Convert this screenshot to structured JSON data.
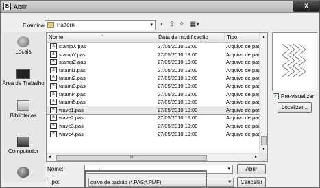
{
  "window": {
    "title": "Abrir",
    "app_icon_glyph": "B",
    "close_glyph": "x"
  },
  "toolbar": {
    "lookin_label": "Examinar:",
    "lookin_value": "Pattern",
    "combo_arrow": "▾",
    "back_glyph": "◐",
    "up_glyph": "⇧",
    "newfolder_glyph": "✧",
    "views_glyph": "▦▾"
  },
  "places": [
    {
      "label": "Locais",
      "icon": "recent-places-icon"
    },
    {
      "label": "Área de Trabalho",
      "icon": "desktop-icon"
    },
    {
      "label": "Bibliotecas",
      "icon": "libraries-icon"
    },
    {
      "label": "Computador",
      "icon": "computer-icon"
    },
    {
      "label": "",
      "icon": "network-icon"
    }
  ],
  "columns": {
    "name": "Nome",
    "date": "Data de modificação",
    "type": "Tipo"
  },
  "sort_arrow": "^",
  "file_icon_glyph": "B",
  "files": [
    {
      "name": "stampX.pas",
      "date": "27/05/2010 19:00",
      "type": "Arquivo de pad"
    },
    {
      "name": "stampY.pas",
      "date": "27/05/2010 19:00",
      "type": "Arquivo de pad"
    },
    {
      "name": "stampZ.pas",
      "date": "27/05/2010 19:00",
      "type": "Arquivo de pad"
    },
    {
      "name": "tatami1.pas",
      "date": "27/05/2010 19:00",
      "type": "Arquivo de pad"
    },
    {
      "name": "tatami2.pas",
      "date": "27/05/2010 19:00",
      "type": "Arquivo de pad"
    },
    {
      "name": "tatami3.pas",
      "date": "27/05/2010 19:00",
      "type": "Arquivo de pad"
    },
    {
      "name": "tatami4.pas",
      "date": "27/05/2010 19:00",
      "type": "Arquivo de pad"
    },
    {
      "name": "tatami5.pas",
      "date": "27/05/2010 19:00",
      "type": "Arquivo de pad"
    },
    {
      "name": "wave1.pas",
      "date": "27/05/2010 19:00",
      "type": "Arquivo de pad",
      "selected": true
    },
    {
      "name": "wave2.pas",
      "date": "27/05/2010 19:00",
      "type": "Arquivo de pad"
    },
    {
      "name": "wave3.pas",
      "date": "27/05/2010 19:00",
      "type": "Arquivo de pad"
    },
    {
      "name": "wave4.pas",
      "date": "27/05/2010 19:00",
      "type": "Arquivo de pad"
    }
  ],
  "scroll": {
    "up": "▴",
    "down": "▾",
    "left": "◂",
    "right": "▸",
    "hthumb_grip": "III"
  },
  "preview": {
    "checkbox_label": "Pré-visualizar",
    "checked_glyph": "✓",
    "find_label": "Localizar..."
  },
  "bottom": {
    "name_label": "Nome:",
    "name_value": "·",
    "type_label": "Tipo:",
    "type_value": "quivo de padrão (*.PAS;*.PMF)",
    "open_label": "Abrir",
    "cancel_label": "Cancelar"
  }
}
